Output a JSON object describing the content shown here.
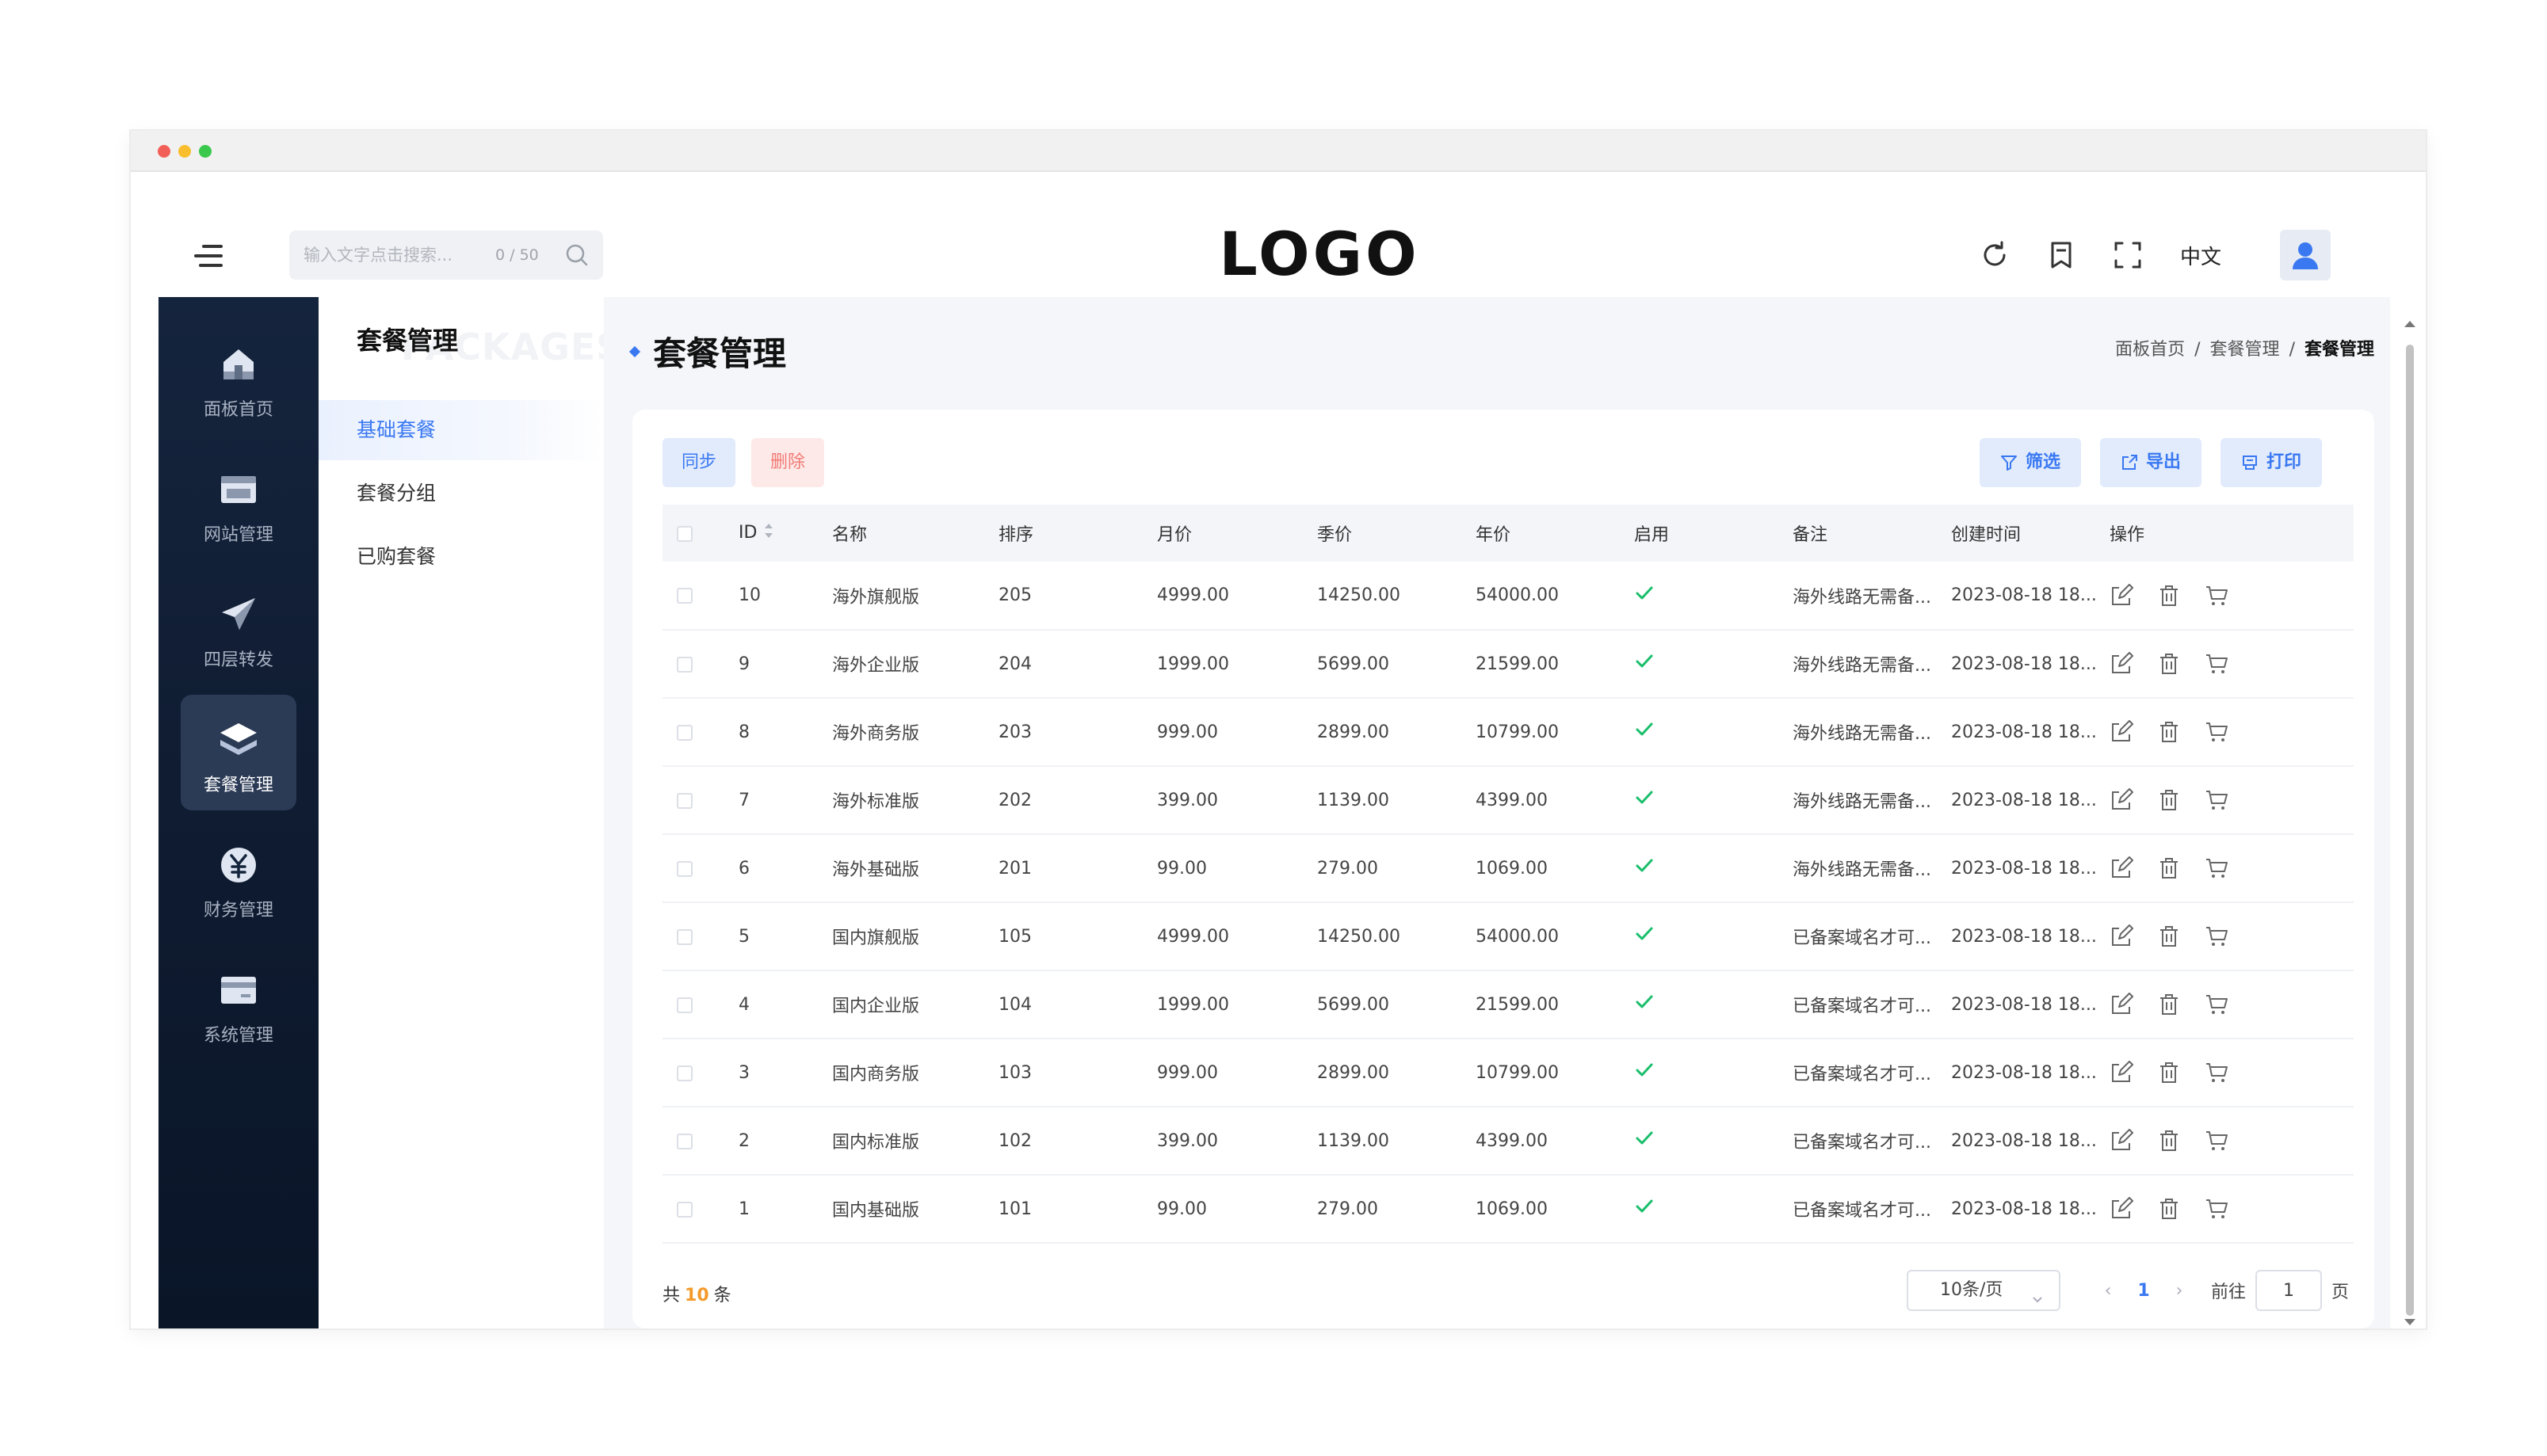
{
  "search": {
    "placeholder": "输入文字点击搜索...",
    "count": "0 / 50"
  },
  "logo": "LOGO",
  "header": {
    "language": "中文"
  },
  "sidebar": {
    "items": [
      {
        "label": "面板首页",
        "icon": "home-icon"
      },
      {
        "label": "网站管理",
        "icon": "website-icon"
      },
      {
        "label": "四层转发",
        "icon": "send-icon"
      },
      {
        "label": "套餐管理",
        "icon": "layers-icon",
        "active": true
      },
      {
        "label": "财务管理",
        "icon": "yen-icon"
      },
      {
        "label": "系统管理",
        "icon": "card-icon"
      }
    ]
  },
  "subnav": {
    "title": "套餐管理",
    "watermark": "PACKAGES",
    "items": [
      {
        "label": "基础套餐",
        "active": true
      },
      {
        "label": "套餐分组"
      },
      {
        "label": "已购套餐"
      }
    ]
  },
  "page": {
    "title": "套餐管理",
    "breadcrumb": [
      "面板首页",
      "套餐管理",
      "套餐管理"
    ]
  },
  "toolbar": {
    "sync_label": "同步",
    "delete_label": "删除",
    "filter_label": "筛选",
    "export_label": "导出",
    "print_label": "打印"
  },
  "table": {
    "columns": [
      "ID",
      "名称",
      "排序",
      "月价",
      "季价",
      "年价",
      "启用",
      "备注",
      "创建时间",
      "操作"
    ],
    "rows": [
      {
        "id": "10",
        "name": "海外旗舰版",
        "sort": "205",
        "month": "4999.00",
        "quarter": "14250.00",
        "year": "54000.00",
        "remark": "海外线路无需备...",
        "created": "2023-08-18 18..."
      },
      {
        "id": "9",
        "name": "海外企业版",
        "sort": "204",
        "month": "1999.00",
        "quarter": "5699.00",
        "year": "21599.00",
        "remark": "海外线路无需备...",
        "created": "2023-08-18 18..."
      },
      {
        "id": "8",
        "name": "海外商务版",
        "sort": "203",
        "month": "999.00",
        "quarter": "2899.00",
        "year": "10799.00",
        "remark": "海外线路无需备...",
        "created": "2023-08-18 18..."
      },
      {
        "id": "7",
        "name": "海外标准版",
        "sort": "202",
        "month": "399.00",
        "quarter": "1139.00",
        "year": "4399.00",
        "remark": "海外线路无需备...",
        "created": "2023-08-18 18..."
      },
      {
        "id": "6",
        "name": "海外基础版",
        "sort": "201",
        "month": "99.00",
        "quarter": "279.00",
        "year": "1069.00",
        "remark": "海外线路无需备...",
        "created": "2023-08-18 18..."
      },
      {
        "id": "5",
        "name": "国内旗舰版",
        "sort": "105",
        "month": "4999.00",
        "quarter": "14250.00",
        "year": "54000.00",
        "remark": "已备案域名才可...",
        "created": "2023-08-18 18..."
      },
      {
        "id": "4",
        "name": "国内企业版",
        "sort": "104",
        "month": "1999.00",
        "quarter": "5699.00",
        "year": "21599.00",
        "remark": "已备案域名才可...",
        "created": "2023-08-18 18..."
      },
      {
        "id": "3",
        "name": "国内商务版",
        "sort": "103",
        "month": "999.00",
        "quarter": "2899.00",
        "year": "10799.00",
        "remark": "已备案域名才可...",
        "created": "2023-08-18 18..."
      },
      {
        "id": "2",
        "name": "国内标准版",
        "sort": "102",
        "month": "399.00",
        "quarter": "1139.00",
        "year": "4399.00",
        "remark": "已备案域名才可...",
        "created": "2023-08-18 18..."
      },
      {
        "id": "1",
        "name": "国内基础版",
        "sort": "101",
        "month": "99.00",
        "quarter": "279.00",
        "year": "1069.00",
        "remark": "已备案域名才可...",
        "created": "2023-08-18 18..."
      }
    ]
  },
  "footer": {
    "total_prefix": "共",
    "total_count": "10",
    "total_suffix": "条",
    "page_size": "10条/页",
    "current_page": "1",
    "goto_label": "前往",
    "goto_value": "1",
    "page_unit": "页"
  },
  "colors": {
    "accent": "#3a78f2",
    "danger": "#f07b75",
    "success": "#19be6b",
    "sidebar": "#15243d"
  }
}
